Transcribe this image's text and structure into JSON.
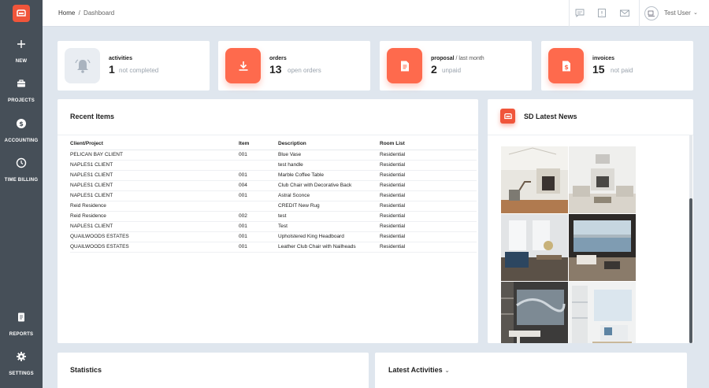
{
  "sidebar": {
    "items": [
      {
        "label": "NEW",
        "icon": "plus-icon"
      },
      {
        "label": "PROJECTS",
        "icon": "briefcase-icon"
      },
      {
        "label": "ACCOUNTING",
        "icon": "dollar-icon"
      },
      {
        "label": "TIME BILLING",
        "icon": "clock-icon"
      },
      {
        "label": "REPORTS",
        "icon": "document-icon"
      },
      {
        "label": "SETTINGS",
        "icon": "gear-icon"
      }
    ]
  },
  "header": {
    "breadcrumb_home": "Home",
    "breadcrumb_sep": "/",
    "breadcrumb_current": "Dashboard",
    "user_name": "Test User",
    "user_chevron": "⌄"
  },
  "stats": [
    {
      "title": "activities",
      "subtitle": "",
      "count": "1",
      "desc": "not completed"
    },
    {
      "title": "orders",
      "subtitle": "",
      "count": "13",
      "desc": "open orders"
    },
    {
      "title": "proposal",
      "subtitle": " / last month",
      "count": "2",
      "desc": "unpaid"
    },
    {
      "title": "invoices",
      "subtitle": "",
      "count": "15",
      "desc": "not paid"
    }
  ],
  "recent": {
    "title": "Recent Items",
    "columns": [
      "Client/Project",
      "Item",
      "Description",
      "Room List"
    ],
    "rows": [
      [
        "PELICAN BAY CLIENT",
        "001",
        "Blue Vase",
        "Residential"
      ],
      [
        "NAPLES1 CLIENT",
        "",
        "test handle",
        "Residential"
      ],
      [
        "NAPLES1 CLIENT",
        "001",
        "Marble Coffee Table",
        "Residential"
      ],
      [
        "NAPLES1 CLIENT",
        "004",
        "Club Chair with Decorative Back",
        "Residential"
      ],
      [
        "NAPLES1 CLIENT",
        "001",
        "Astral Sconce",
        "Residential"
      ],
      [
        "Reid Residence",
        "",
        "CREDIT New Rug",
        "Residential"
      ],
      [
        "Reid Residence",
        "002",
        "test",
        "Residential"
      ],
      [
        "NAPLES1 CLIENT",
        "001",
        "Test",
        "Residential"
      ],
      [
        "QUAILWOODS ESTATES",
        "001",
        "Upholstered King Headboard",
        "Residential"
      ],
      [
        "QUAILWOODS ESTATES",
        "001",
        "Leather Club Chair with Nailheads",
        "Residential"
      ]
    ]
  },
  "news": {
    "title": "SD Latest News"
  },
  "bottom": {
    "statistics_title": "Statistics",
    "activities_title": "Latest Activities",
    "activities_chevron": "⌄"
  },
  "colors": {
    "accent": "#fe6a4d",
    "sidebar": "#464f58",
    "background": "#dfe6ee"
  }
}
